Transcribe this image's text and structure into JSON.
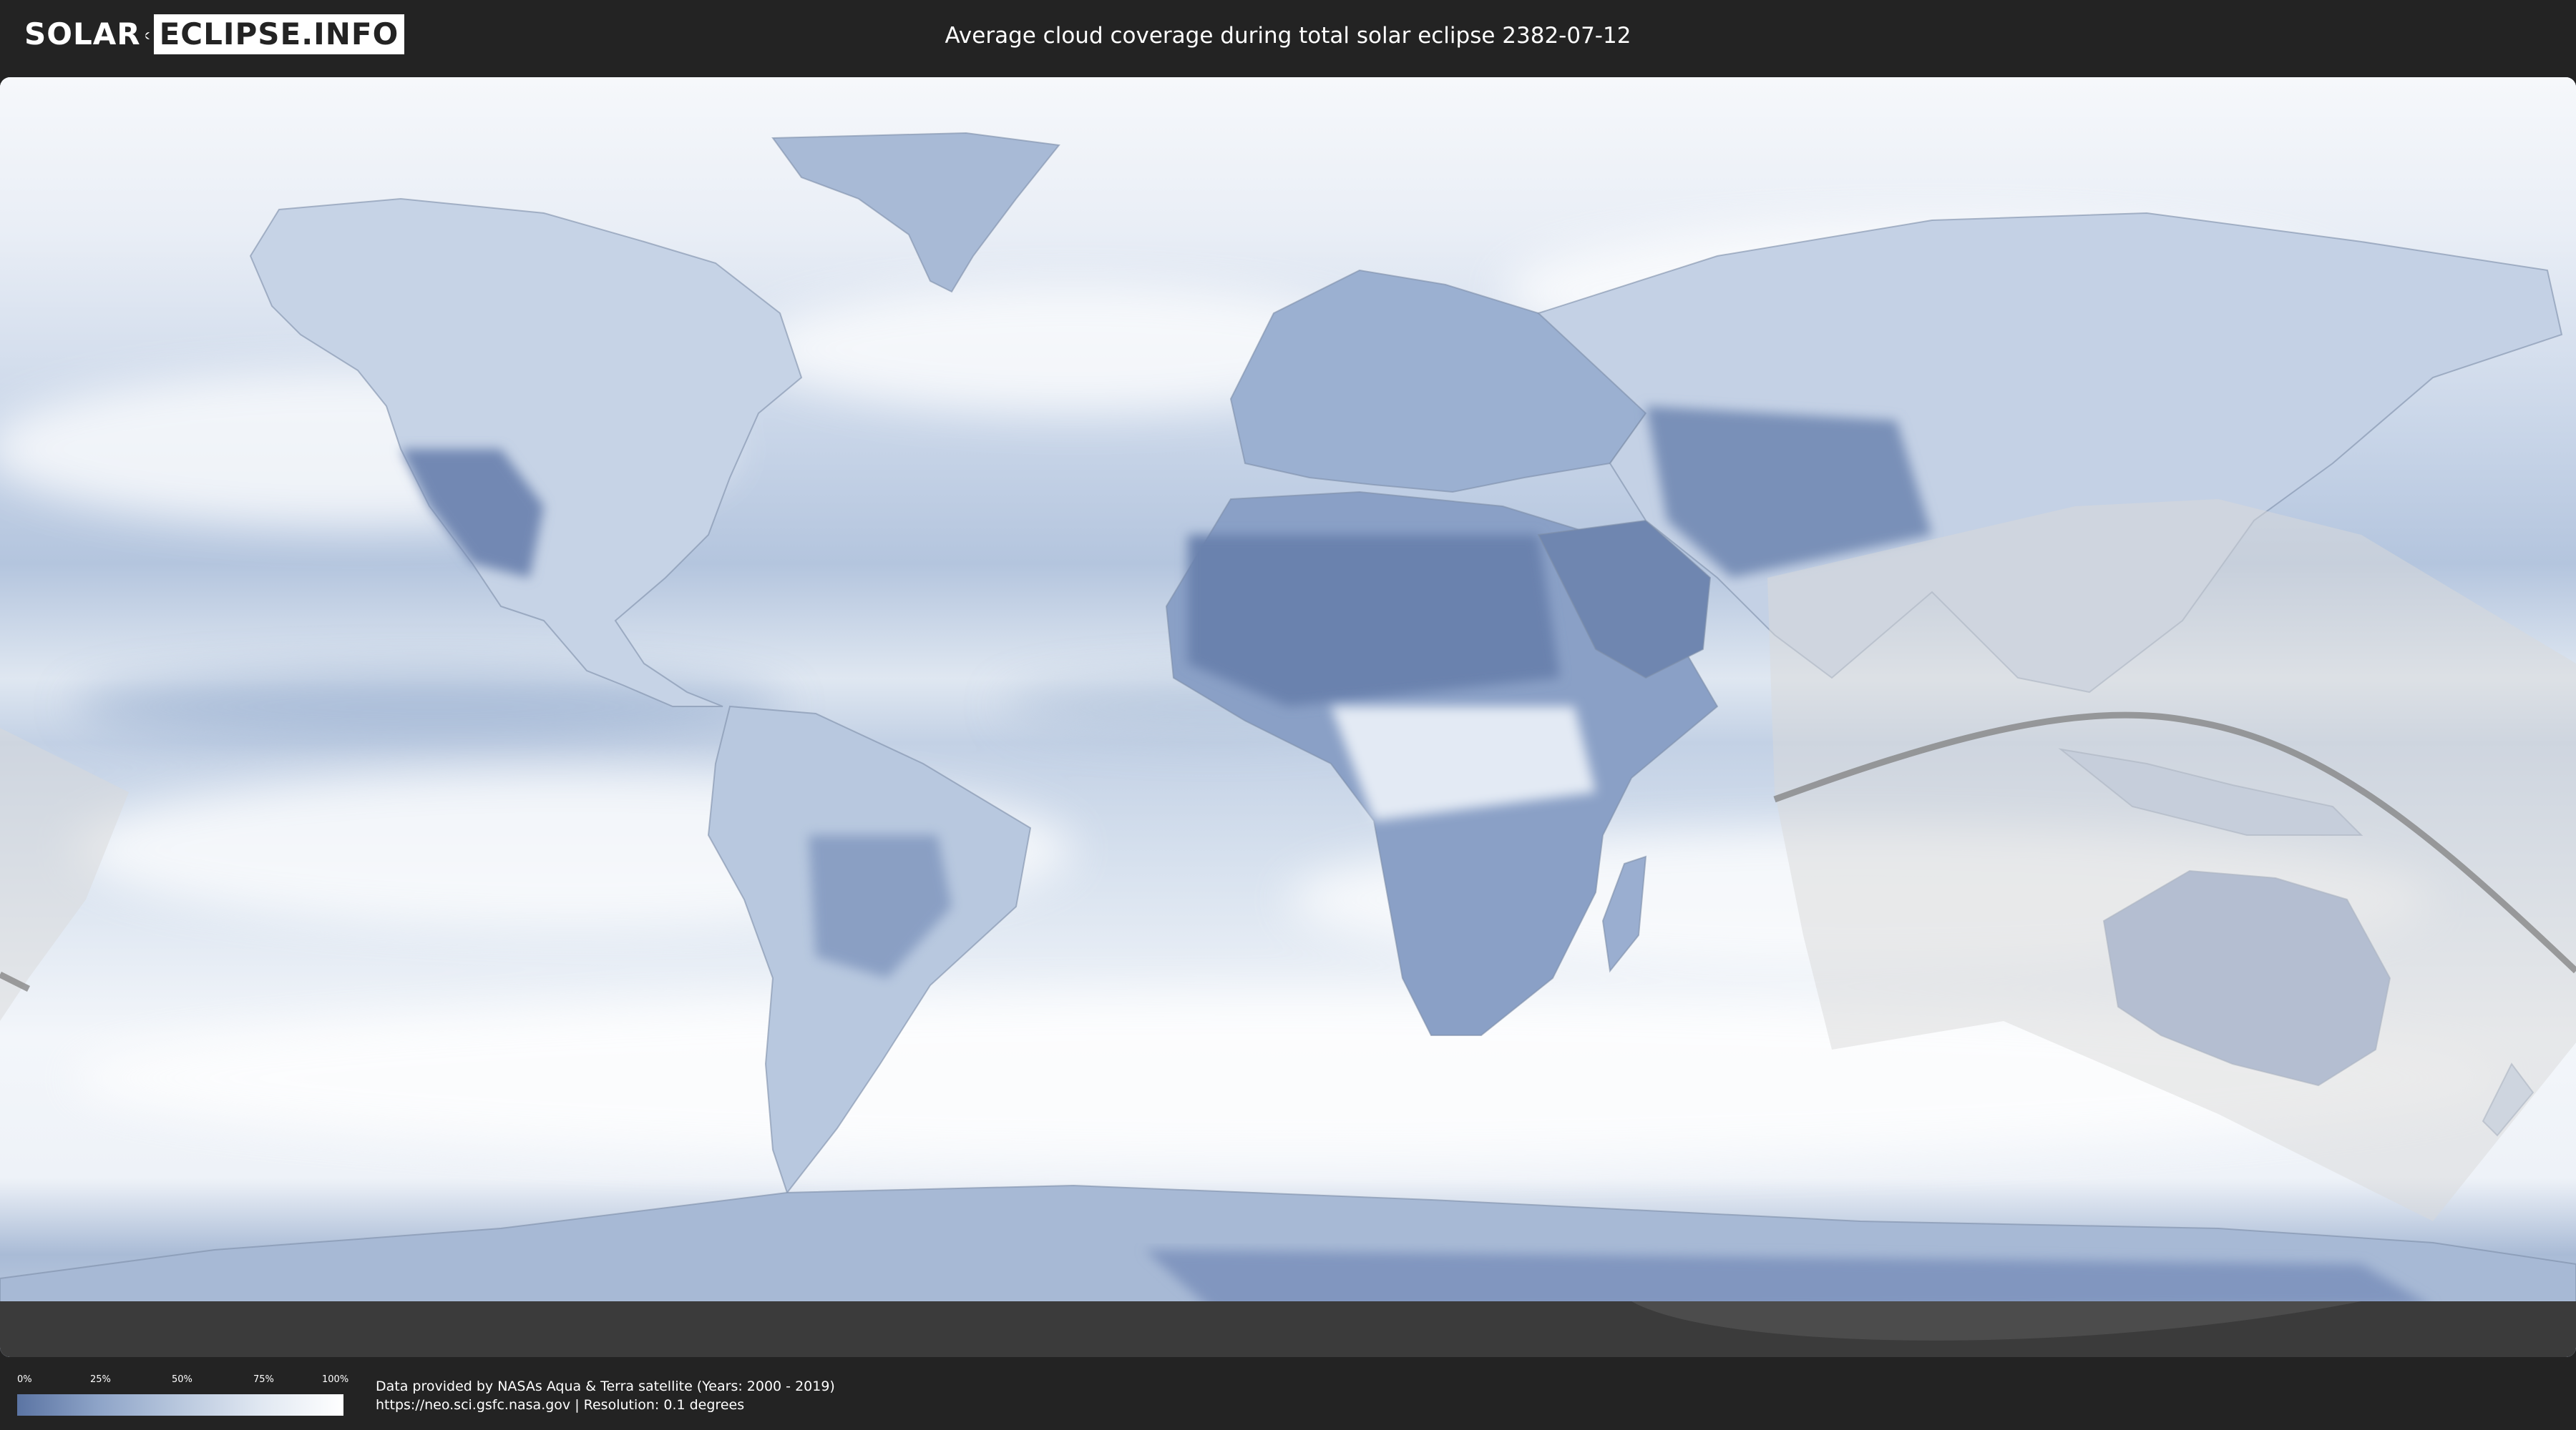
{
  "header": {
    "logo_part1": "SOLAR",
    "logo_part2": "ECLIPSE.INFO",
    "title": "Average cloud coverage during total solar eclipse 2382-07-12"
  },
  "legend": {
    "ticks": [
      "0%",
      "25%",
      "50%",
      "75%",
      "100%"
    ],
    "color_low": "#5b74a3",
    "color_high": "#ffffff"
  },
  "credits": {
    "line1": "Data provided by NASAs Aqua & Terra satellite (Years: 2000 - 2019)",
    "line2": "https://neo.sci.gsfc.nasa.gov | Resolution: 0.1 degrees"
  },
  "map": {
    "projection": "equirectangular",
    "colors": {
      "ocean_clear": "#9fb4d3",
      "cloud": "#f4f7fb",
      "land_dry": "#6a82ae",
      "path_overlay": "#d9d9d9",
      "central_line": "#808080",
      "bottom_band": "#3a3a3a"
    }
  }
}
